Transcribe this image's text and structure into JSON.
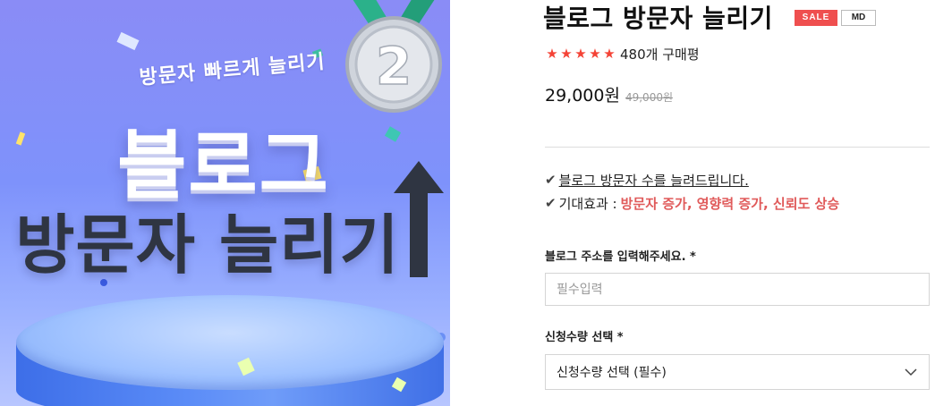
{
  "banner": {
    "subtitle": "방문자 빠르게 늘리기",
    "title_line1": "블로그",
    "title_line2": "방문자 늘리기",
    "medal_number": "2"
  },
  "product": {
    "title": "블로그 방문자 늘리기",
    "badges": {
      "sale": "SALE",
      "md": "MD"
    },
    "rating": {
      "stars": 5,
      "star_char": "★",
      "review_count": "480개 구매평"
    },
    "price": "29,000원",
    "original_price": "49,000원",
    "features": {
      "line1_check": "✔",
      "line1_text": "블로그 방문자 수를 늘려드립니다.",
      "line2_check": "✔",
      "line2_prefix": "기대효과 :",
      "line2_highlight": "방문자 증가, 영향력 증가, 신뢰도 상승"
    }
  },
  "form": {
    "blog_address_label": "블로그 주소를 입력해주세요. *",
    "blog_address_placeholder": "필수입력",
    "blog_address_value": "",
    "quantity_label": "신청수량 선택 *",
    "quantity_selected": "신청수량 선택 (필수)"
  },
  "colors": {
    "accent_red": "#ef4f4f",
    "star_red": "#f44336",
    "highlight_red": "#e05a5a",
    "banner_bg": "#7e92fb"
  },
  "icons": {
    "chevron": "chevron-down-icon",
    "check": "check-icon",
    "star": "star-icon",
    "medal": "medal-icon",
    "arrow": "arrow-up-icon"
  }
}
